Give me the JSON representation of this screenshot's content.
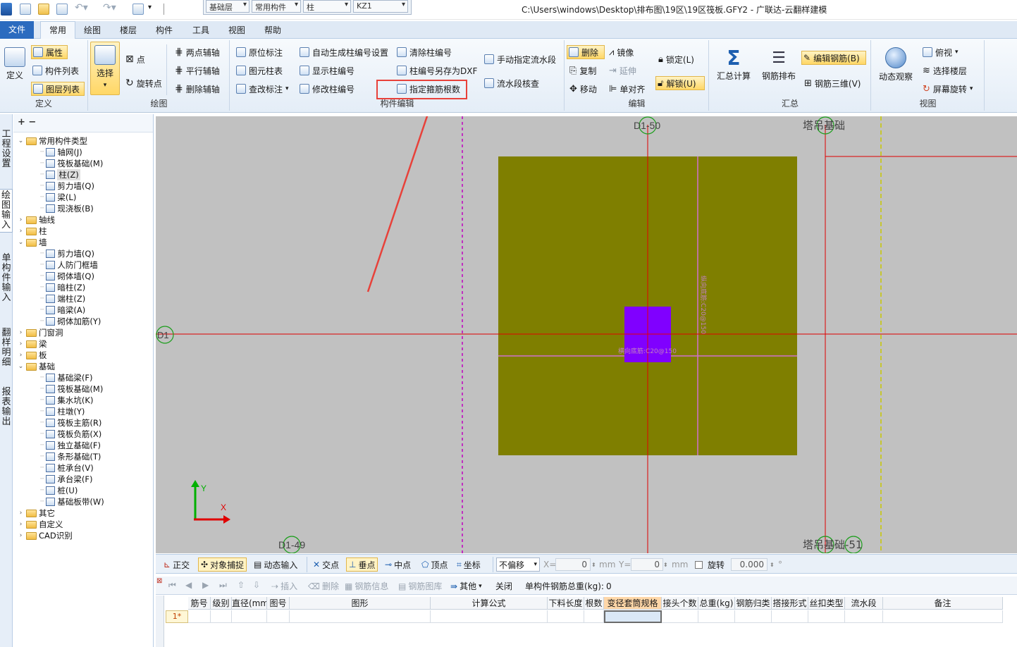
{
  "titlebar": {
    "floor_combo": "基础层",
    "type_combo": "常用构件",
    "element_combo": "柱",
    "name_combo": "KZ1",
    "window_title": "C:\\Users\\windows\\Desktop\\排布图\\19区\\19区筏板.GFY2 - 广联达-云翻样建模"
  },
  "menu": {
    "file": "文件",
    "items": [
      "常用",
      "绘图",
      "楼层",
      "构件",
      "工具",
      "视图",
      "帮助"
    ]
  },
  "ribbon": {
    "define": {
      "label": "定义",
      "define_btn": "定义",
      "attr": "属性",
      "component_list": "构件列表",
      "layer_list": "图层列表"
    },
    "draw": {
      "label": "绘图",
      "select": "选择",
      "point": "点",
      "rotate_point": "旋转点",
      "two_point_aux": "两点辅轴",
      "parallel_aux": "平行辅轴",
      "delete_aux": "删除辅轴"
    },
    "component_edit": {
      "label": "构件编辑",
      "in_place_label": "原位标注",
      "element_column_table": "图元柱表",
      "check_label": "查改标注",
      "auto_number_settings": "自动生成柱编号设置",
      "show_number": "显示柱编号",
      "modify_number": "修改柱编号",
      "clear_number": "清除柱编号",
      "save_as_dxf": "柱编号另存为DXF",
      "assign_stirrup_count": "指定箍筋根数",
      "manual_segment": "手动指定流水段",
      "check_segment": "流水段核查"
    },
    "edit": {
      "label": "编辑",
      "delete": "删除",
      "copy": "复制",
      "move": "移动",
      "mirror": "镜像",
      "extend": "延伸",
      "align": "单对齐",
      "lock": "锁定(L)",
      "unlock": "解锁(U)"
    },
    "summary": {
      "label": "汇总",
      "calc": "汇总计算",
      "rebar_layout": "钢筋排布",
      "edit_rebar": "编辑钢筋(B)",
      "rebar_3d": "钢筋三维(V)"
    },
    "view": {
      "label": "视图",
      "dynamic_observe": "动态观察",
      "top_view": "俯视",
      "select_floor": "选择楼层",
      "screen_rotate": "屏幕旋转"
    }
  },
  "left_tabs": [
    "工程设置",
    "绘图输入",
    "单构件输入",
    "翻样明细",
    "报表输出"
  ],
  "tree": {
    "toolbar": "+ −",
    "nodes": [
      {
        "label": "常用构件类型",
        "level": 0,
        "kind": "folder",
        "open": true
      },
      {
        "label": "轴网(J)",
        "level": 1,
        "kind": "item"
      },
      {
        "label": "筏板基础(M)",
        "level": 1,
        "kind": "item"
      },
      {
        "label": "柱(Z)",
        "level": 1,
        "kind": "item",
        "selected": true
      },
      {
        "label": "剪力墙(Q)",
        "level": 1,
        "kind": "item"
      },
      {
        "label": "梁(L)",
        "level": 1,
        "kind": "item"
      },
      {
        "label": "现浇板(B)",
        "level": 1,
        "kind": "item"
      },
      {
        "label": "轴线",
        "level": 0,
        "kind": "folder",
        "open": false
      },
      {
        "label": "柱",
        "level": 0,
        "kind": "folder",
        "open": false
      },
      {
        "label": "墙",
        "level": 0,
        "kind": "folder",
        "open": true
      },
      {
        "label": "剪力墙(Q)",
        "level": 1,
        "kind": "item"
      },
      {
        "label": "人防门框墙",
        "level": 1,
        "kind": "item"
      },
      {
        "label": "砌体墙(Q)",
        "level": 1,
        "kind": "item"
      },
      {
        "label": "暗柱(Z)",
        "level": 1,
        "kind": "item"
      },
      {
        "label": "端柱(Z)",
        "level": 1,
        "kind": "item"
      },
      {
        "label": "暗梁(A)",
        "level": 1,
        "kind": "item"
      },
      {
        "label": "砌体加筋(Y)",
        "level": 1,
        "kind": "item"
      },
      {
        "label": "门窗洞",
        "level": 0,
        "kind": "folder",
        "open": false
      },
      {
        "label": "梁",
        "level": 0,
        "kind": "folder",
        "open": false
      },
      {
        "label": "板",
        "level": 0,
        "kind": "folder",
        "open": false
      },
      {
        "label": "基础",
        "level": 0,
        "kind": "folder",
        "open": true
      },
      {
        "label": "基础梁(F)",
        "level": 1,
        "kind": "item"
      },
      {
        "label": "筏板基础(M)",
        "level": 1,
        "kind": "item"
      },
      {
        "label": "集水坑(K)",
        "level": 1,
        "kind": "item"
      },
      {
        "label": "柱墩(Y)",
        "level": 1,
        "kind": "item"
      },
      {
        "label": "筏板主筋(R)",
        "level": 1,
        "kind": "item"
      },
      {
        "label": "筏板负筋(X)",
        "level": 1,
        "kind": "item"
      },
      {
        "label": "独立基础(F)",
        "level": 1,
        "kind": "item"
      },
      {
        "label": "条形基础(T)",
        "level": 1,
        "kind": "item"
      },
      {
        "label": "桩承台(V)",
        "level": 1,
        "kind": "item"
      },
      {
        "label": "承台梁(F)",
        "level": 1,
        "kind": "item"
      },
      {
        "label": "桩(U)",
        "level": 1,
        "kind": "item"
      },
      {
        "label": "基础板带(W)",
        "level": 1,
        "kind": "item"
      },
      {
        "label": "其它",
        "level": 0,
        "kind": "folder",
        "open": false
      },
      {
        "label": "自定义",
        "level": 0,
        "kind": "folder",
        "open": false
      },
      {
        "label": "CAD识别",
        "level": 0,
        "kind": "folder",
        "open": false
      }
    ]
  },
  "canvas": {
    "axis_top_1": "D1-50",
    "axis_top_2": "塔吊基础",
    "axis_left": "D1",
    "axis_bottom_1": "D1-49",
    "axis_bottom_2": "塔吊基础-51",
    "rebar_h_label": "横向底筋:C20@150",
    "rebar_v_label": "纵向底筋:C20@150",
    "colors": {
      "background": "#c1c1c1",
      "slab": "#7f7f00",
      "column": "#8000ff",
      "axis": "#e00000",
      "rebar": "#d070d0",
      "guide_magenta": "#c000c0",
      "guide_yellow": "#c8c800",
      "axis_circle": "#1a9e1a"
    }
  },
  "snapbar": {
    "ortho": "正交",
    "object_snap": "对象捕捉",
    "dynamic_input": "动态输入",
    "intersection": "交点",
    "perpendicular": "垂点",
    "midpoint": "中点",
    "vertex": "顶点",
    "coordinate": "坐标",
    "offset_mode": "不偏移",
    "x_label": "X=",
    "x_value": "0",
    "y_label": "Y=",
    "y_value": "0",
    "unit": "mm",
    "rotate": "旋转",
    "rotate_value": "0.000",
    "degree": "°"
  },
  "grid_toolbar": {
    "insert": "插入",
    "delete": "删除",
    "rebar_info": "钢筋信息",
    "rebar_library": "钢筋图库",
    "other": "其他",
    "close": "关闭",
    "total_weight_label": "单构件钢筋总重(kg):",
    "total_weight_value": "0"
  },
  "grid": {
    "headers": [
      "筋号",
      "级别",
      "直径(mm)",
      "图号",
      "图形",
      "计算公式",
      "下料长度",
      "根数",
      "变径套筒规格",
      "接头个数",
      "总重(kg)",
      "钢筋归类",
      "搭接形式",
      "丝扣类型",
      "流水段",
      "备注"
    ],
    "row_label": "1*"
  }
}
